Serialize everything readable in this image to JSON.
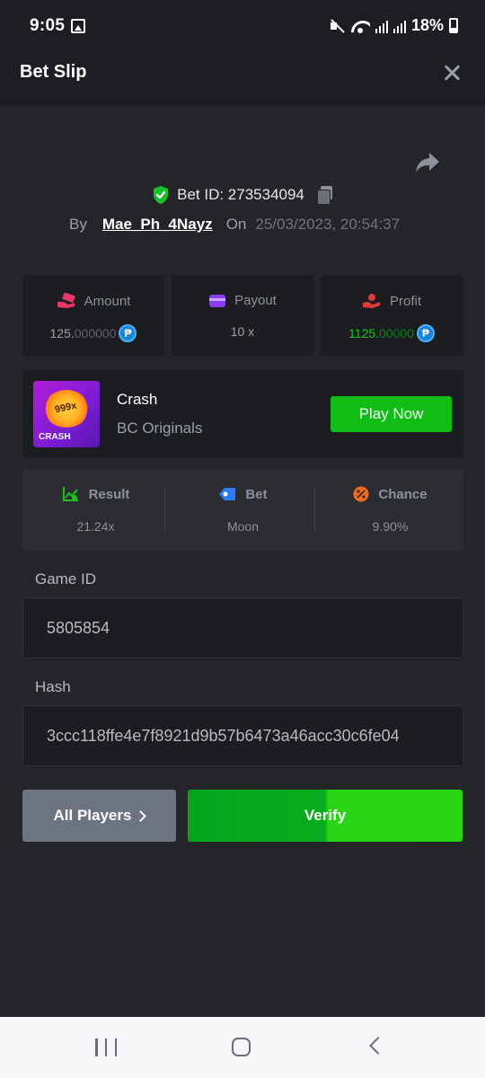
{
  "status_bar": {
    "time": "9:05",
    "battery": "18%"
  },
  "header": {
    "title": "Bet Slip"
  },
  "bet": {
    "id_label": "Bet ID: 273534094",
    "by_label": "By",
    "username": "Mae_Ph_4Nayz",
    "on_label": "On",
    "datetime": "25/03/2023, 20:54:37"
  },
  "stats": {
    "amount": {
      "label": "Amount",
      "value_main": "125.",
      "value_dim": "000000"
    },
    "payout": {
      "label": "Payout",
      "value": "10 x"
    },
    "profit": {
      "label": "Profit",
      "value_main": "1125.",
      "value_dim": "00000"
    }
  },
  "currency_symbol": "₱",
  "game": {
    "name": "Crash",
    "provider": "BC Originals",
    "play_label": "Play Now",
    "thumb_number": "999x",
    "thumb_label": "CRASH"
  },
  "result": {
    "result_label": "Result",
    "result_value": "21.24x",
    "bet_label": "Bet",
    "bet_value": "Moon",
    "chance_label": "Chance",
    "chance_value": "9.90%"
  },
  "fields": {
    "game_id_label": "Game ID",
    "game_id_value": "5805854",
    "hash_label": "Hash",
    "hash_value": "3ccc118ffe4e7f8921d9b57b6473a46acc30c6fe04"
  },
  "buttons": {
    "all_players": "All Players",
    "verify": "Verify"
  },
  "colors": {
    "accent_green": "#0fbd14",
    "profit_green": "#1fc21a",
    "amount_pink": "#e8356a",
    "payout_purple": "#8a3cf0",
    "profit_red": "#e23a3a",
    "bet_blue": "#2d7bf5",
    "chance_orange": "#f26a1b"
  }
}
